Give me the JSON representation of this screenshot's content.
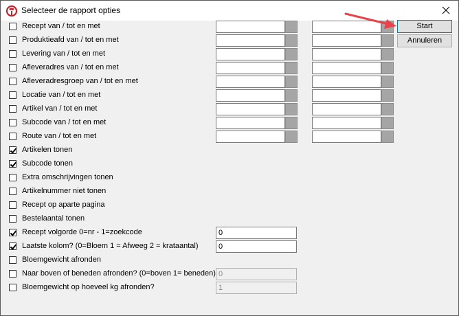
{
  "window": {
    "title": "Selecteer de rapport opties",
    "close_icon": "close-icon",
    "app_icon": "app-logo-icon",
    "accent": "#c0262c"
  },
  "buttons": {
    "start": "Start",
    "cancel": "Annuleren"
  },
  "range_rows": [
    {
      "label": "Recept van / tot en met",
      "checked": false,
      "from": "",
      "to": ""
    },
    {
      "label": "Produktieafd van / tot en met",
      "checked": false,
      "from": "",
      "to": ""
    },
    {
      "label": "Levering van / tot en met",
      "checked": false,
      "from": "",
      "to": ""
    },
    {
      "label": "Afleveradres van / tot en met",
      "checked": false,
      "from": "",
      "to": ""
    },
    {
      "label": "Afleveradresgroep van / tot en met",
      "checked": false,
      "from": "",
      "to": ""
    },
    {
      "label": "Locatie van / tot en met",
      "checked": false,
      "from": "",
      "to": ""
    },
    {
      "label": "Artikel van / tot en met",
      "checked": false,
      "from": "",
      "to": ""
    },
    {
      "label": "Subcode van / tot en met",
      "checked": false,
      "from": "",
      "to": ""
    },
    {
      "label": "Route van / tot en met",
      "checked": false,
      "from": "",
      "to": ""
    }
  ],
  "option_rows": [
    {
      "label": "Artikelen tonen",
      "checked": true
    },
    {
      "label": "Subcode tonen",
      "checked": true
    },
    {
      "label": "Extra omschrijvingen tonen",
      "checked": false
    },
    {
      "label": "Artikelnummer niet tonen",
      "checked": false
    },
    {
      "label": "Recept op aparte pagina",
      "checked": false
    },
    {
      "label": "Bestelaantal tonen",
      "checked": false
    }
  ],
  "value_rows": [
    {
      "label": "Recept volgorde 0=nr - 1=zoekcode",
      "checked": true,
      "value": "0",
      "disabled": false
    },
    {
      "label": "Laatste kolom? (0=Bloem 1 = Afweeg 2 = krataantal)",
      "checked": true,
      "value": "0",
      "disabled": false
    },
    {
      "label": "Bloemgewicht afronden",
      "checked": false,
      "value": null,
      "disabled": false
    },
    {
      "label": "Naar boven of beneden afronden? (0=boven 1= beneden)",
      "checked": false,
      "value": "0",
      "disabled": true
    },
    {
      "label": "Bloemgewicht op hoeveel kg afronden?",
      "checked": false,
      "value": "1",
      "disabled": true
    }
  ],
  "annotation": {
    "arrow_color": "#e8434a"
  }
}
